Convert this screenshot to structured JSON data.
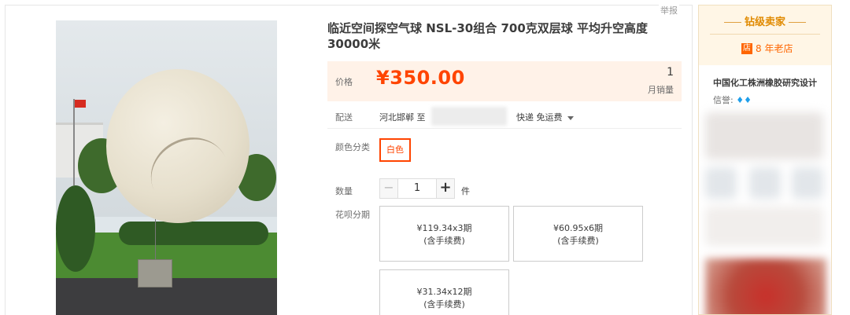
{
  "report_label": "举报",
  "product": {
    "title": "临近空间探空气球 NSL-30组合 700克双层球 平均升空高度30000米",
    "price_label": "价格",
    "price": "¥350.00",
    "monthly_sales_count": "1",
    "monthly_sales_label": "月销量"
  },
  "delivery": {
    "label": "配送",
    "from": "河北邯郸 至",
    "shipping": "快递 免运费"
  },
  "color": {
    "label": "颜色分类",
    "selected": "白色"
  },
  "quantity": {
    "label": "数量",
    "minus": "−",
    "value": "1",
    "plus": "+",
    "unit": "件"
  },
  "installments": {
    "label": "花呗分期",
    "options": [
      {
        "line1": "¥119.34x3期",
        "line2": "(含手续费)"
      },
      {
        "line1": "¥60.95x6期",
        "line2": "(含手续费)"
      },
      {
        "line1": "¥31.34x12期",
        "line2": "(含手续费)"
      }
    ]
  },
  "seller": {
    "level": "钻级卖家",
    "shop_badge": "店",
    "shop_age": "8 年老店",
    "name": "中国化工株洲橡胶研究设计",
    "credit_label": "信誉:",
    "credit_icons": [
      "diamond-icon",
      "diamond-icon"
    ],
    "accent_color": "#f60"
  },
  "colors": {
    "price": "#ff4400",
    "price_bg": "#fff2e8",
    "selected_border": "#ff4400"
  }
}
